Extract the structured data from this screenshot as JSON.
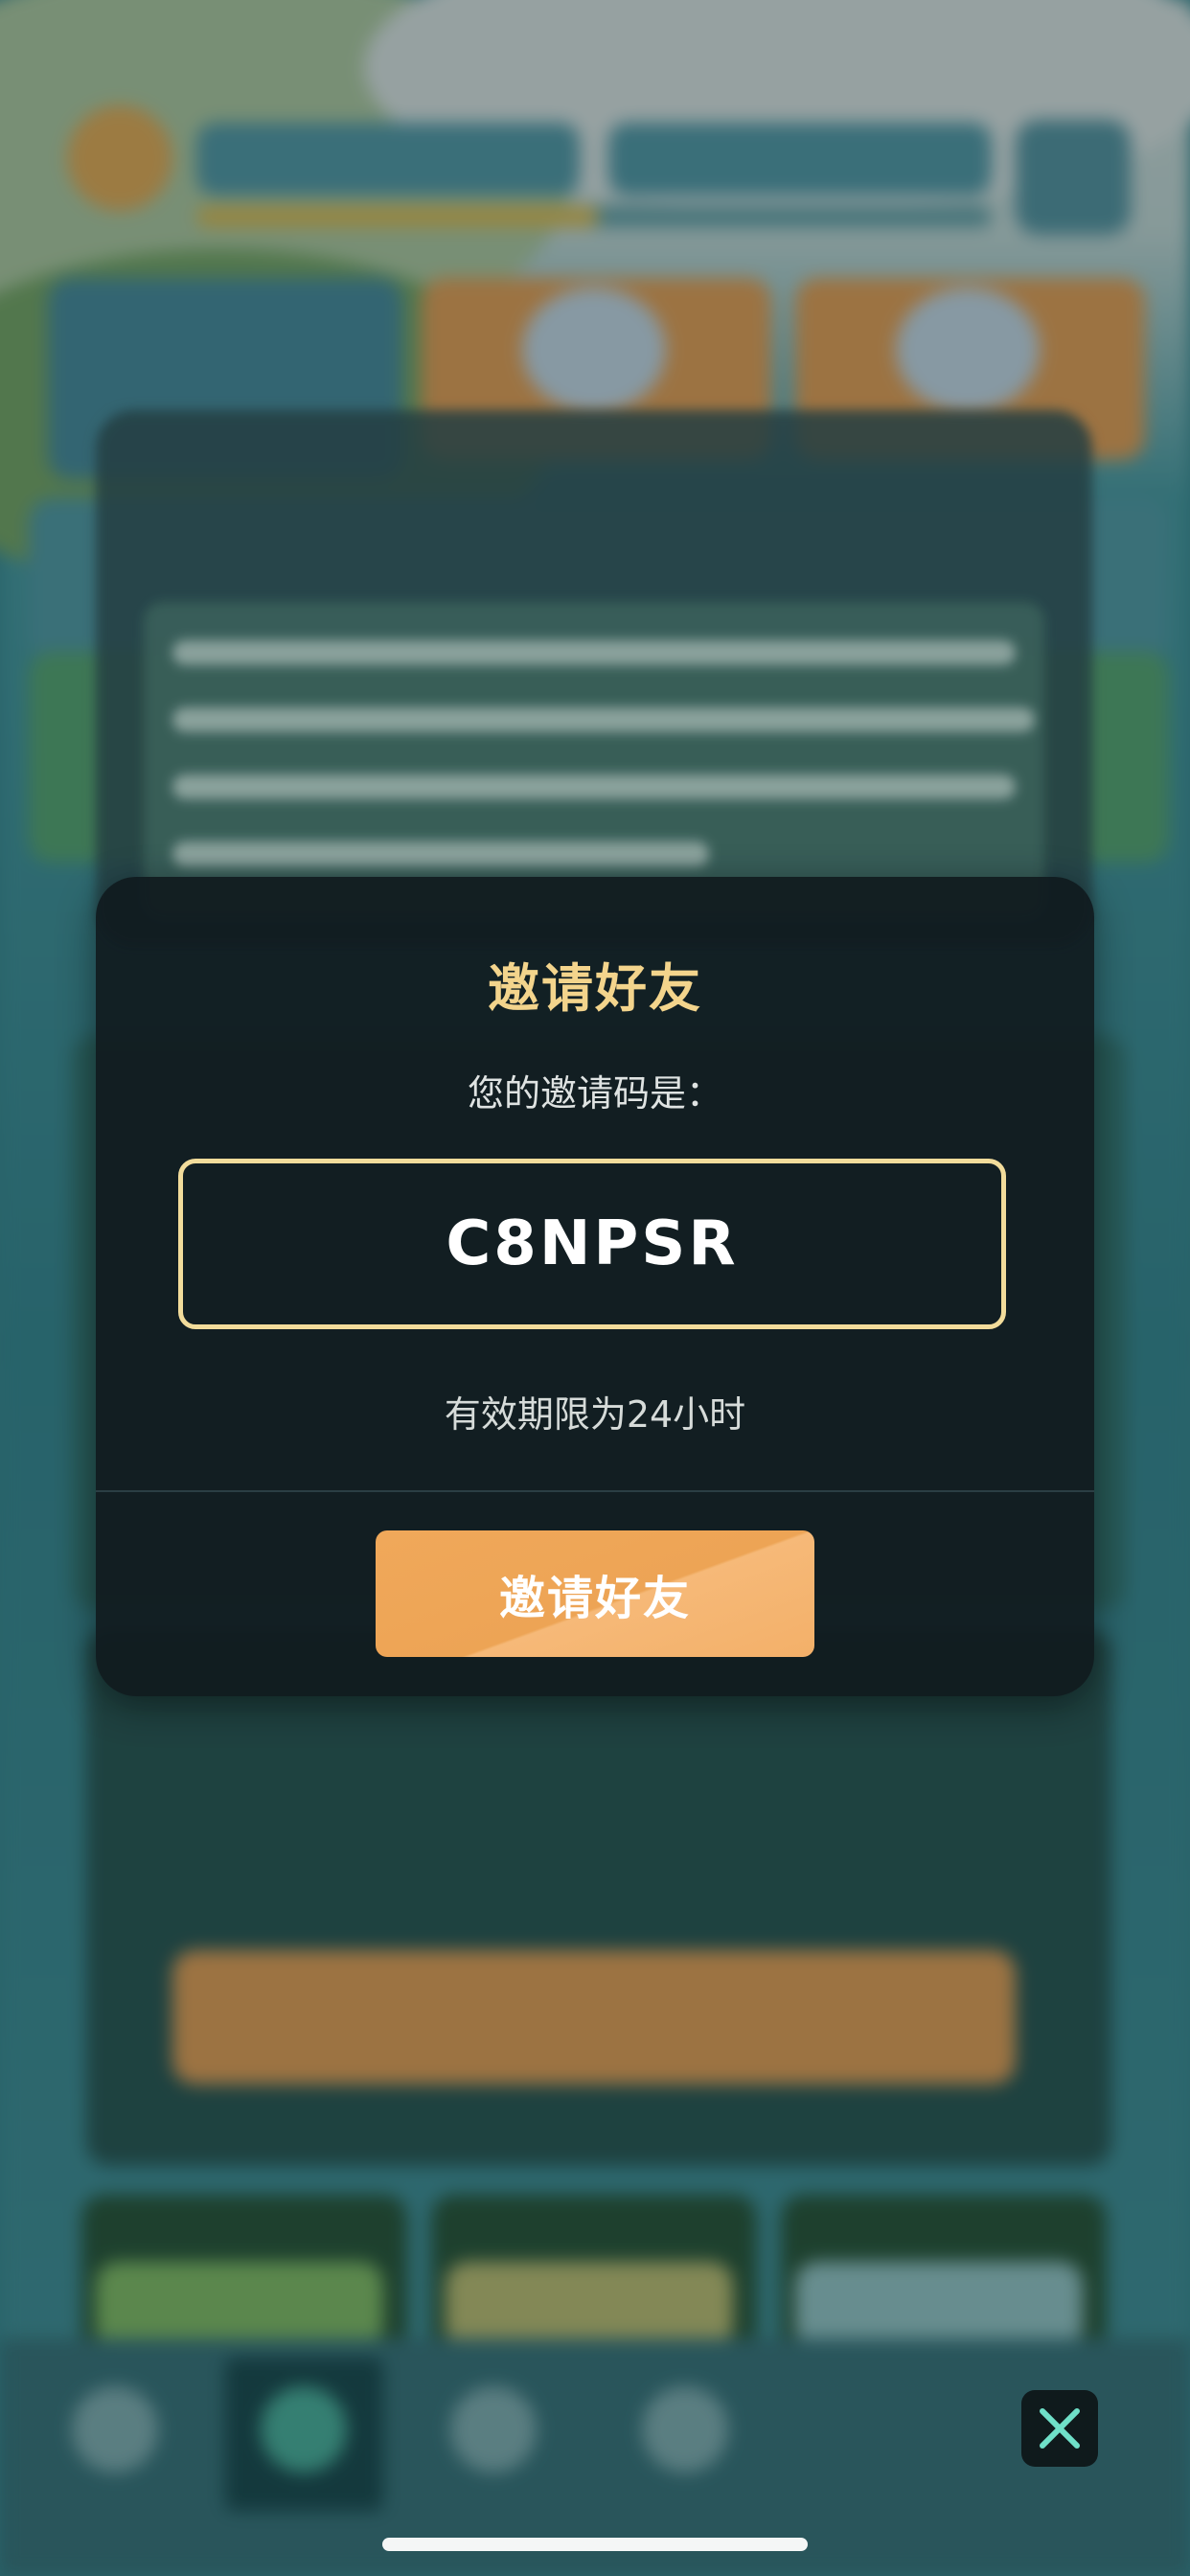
{
  "modal": {
    "title": "邀请好友",
    "code_label": "您的邀请码是：",
    "code": "C8NPSR",
    "validity": "有效期限为24小时",
    "invite_button": "邀请好友"
  },
  "colors": {
    "title": "#f3d48c",
    "code_border": "#f2dc9b",
    "button": "#f0a85a",
    "close_icon": "#6fe0c8"
  },
  "icons": {
    "close": "close-x-icon"
  }
}
